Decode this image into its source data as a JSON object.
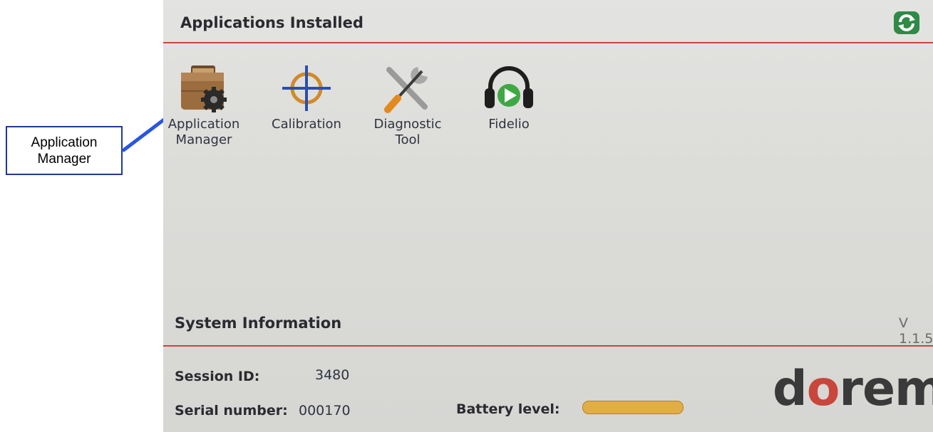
{
  "callout": {
    "line1": "Application",
    "line2": "Manager",
    "color": "#1f3a93"
  },
  "header": {
    "title": "Applications Installed",
    "refresh_icon": "refresh-icon"
  },
  "apps": [
    {
      "label": "Application\nManager",
      "icon": "briefcase-gear-icon"
    },
    {
      "label": "Calibration",
      "icon": "crosshair-icon"
    },
    {
      "label": "Diagnostic\nTool",
      "icon": "wrench-screwdriver-icon"
    },
    {
      "label": "Fidelio",
      "icon": "headphones-play-icon"
    }
  ],
  "system": {
    "title": "System Information",
    "version": "V 1.1.5",
    "session_label": "Session ID:",
    "session_value": "3480",
    "serial_label": "Serial number:",
    "serial_value": "000170",
    "battery_label": "Battery level:",
    "battery_level": 1.0
  },
  "brand": {
    "logo_text": "doremi",
    "accent_color": "#c8463c"
  }
}
